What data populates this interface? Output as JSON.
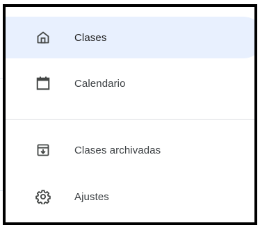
{
  "nav": {
    "items": [
      {
        "label": "Clases",
        "icon": "home-icon",
        "active": true
      },
      {
        "label": "Calendario",
        "icon": "calendar-icon",
        "active": false
      },
      {
        "label": "Clases archivadas",
        "icon": "archive-icon",
        "active": false
      },
      {
        "label": "Ajustes",
        "icon": "settings-gear-icon",
        "active": false
      }
    ]
  },
  "colors": {
    "active_background": "#e8f0fe",
    "text": "#3c4043",
    "icon": "#444746",
    "divider": "#dadce0",
    "frame_border": "#000000"
  }
}
